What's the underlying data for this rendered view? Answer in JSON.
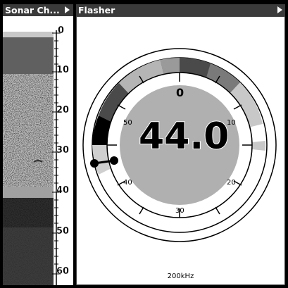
{
  "sonar_chart": {
    "title": "Sonar Ch...",
    "depth_labels": [
      "0",
      "10",
      "20",
      "30",
      "40",
      "50",
      "60"
    ]
  },
  "flasher": {
    "title": "Flasher",
    "depth_readout": "44.0",
    "dial_labels": [
      "0",
      "10",
      "20",
      "30",
      "40",
      "50"
    ],
    "frequency": "200kHz"
  },
  "colors": {
    "titlebar": "#3a3a3a",
    "dial_gray": "#b0b0b0",
    "background": "#ffffff"
  }
}
